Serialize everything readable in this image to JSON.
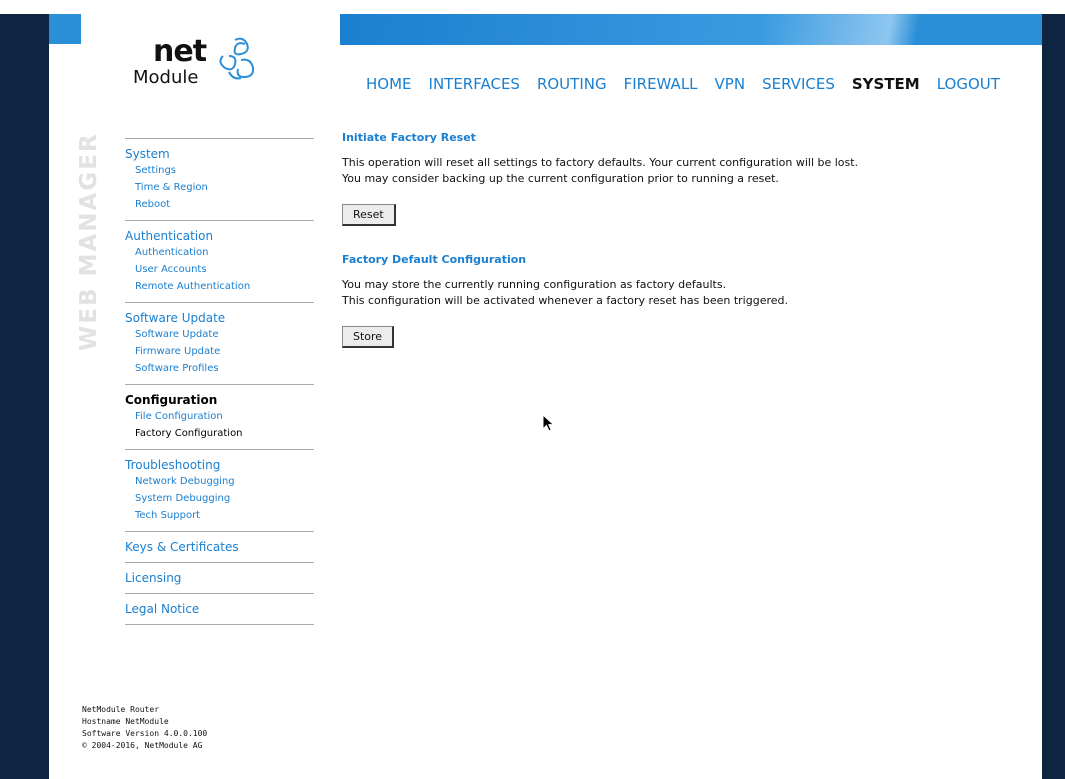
{
  "logo": {
    "net": "net",
    "module": "Module"
  },
  "side_label": "WEB MANAGER",
  "mainnav": [
    {
      "label": "HOME"
    },
    {
      "label": "INTERFACES"
    },
    {
      "label": "ROUTING"
    },
    {
      "label": "FIREWALL"
    },
    {
      "label": "VPN"
    },
    {
      "label": "SERVICES"
    },
    {
      "label": "SYSTEM",
      "active": true
    },
    {
      "label": "LOGOUT"
    }
  ],
  "sidebar": {
    "groups": [
      {
        "title": "System",
        "items": [
          "Settings",
          "Time & Region",
          "Reboot"
        ]
      },
      {
        "title": "Authentication",
        "items": [
          "Authentication",
          "User Accounts",
          "Remote Authentication"
        ]
      },
      {
        "title": "Software Update",
        "items": [
          "Software Update",
          "Firmware Update",
          "Software Profiles"
        ]
      },
      {
        "title": "Configuration",
        "items": [
          "File Configuration",
          "Factory Configuration"
        ]
      },
      {
        "title": "Troubleshooting",
        "items": [
          "Network Debugging",
          "System Debugging",
          "Tech Support"
        ]
      },
      {
        "title": "Keys & Certificates"
      },
      {
        "title": "Licensing"
      },
      {
        "title": "Legal Notice"
      }
    ]
  },
  "content": {
    "reset": {
      "heading": "Initiate Factory Reset",
      "line1": "This operation will reset all settings to factory defaults. Your current configuration will be lost.",
      "line2": "You may consider backing up the current configuration prior to running a reset.",
      "button": "Reset"
    },
    "defaults": {
      "heading": "Factory Default Configuration",
      "line1": "You may store the currently running configuration as factory defaults.",
      "line2": "This configuration will be activated whenever a factory reset has been triggered.",
      "button": "Store"
    }
  },
  "footer": {
    "product": "NetModule Router",
    "hostname": "Hostname NetModule",
    "version": "Software Version 4.0.0.100",
    "copyright": "© 2004-2016, NetModule AG"
  },
  "colors": {
    "accent": "#1a7fd0",
    "banner": "#2a8fd6",
    "page_bg": "#0d2540"
  }
}
